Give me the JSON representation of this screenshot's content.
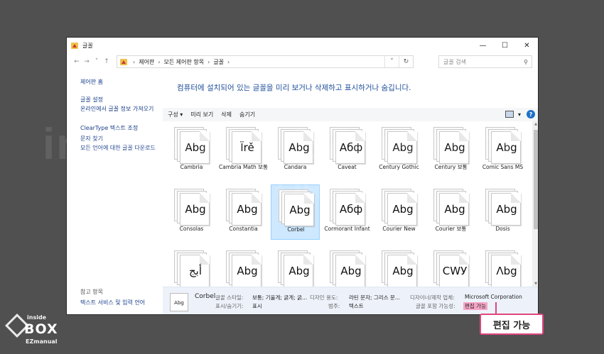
{
  "watermark": {
    "line1": "insideBOX EZmanual",
    "line2": "TUTORIAL"
  },
  "window": {
    "title": "글꼴",
    "controls": [
      "—",
      "☐",
      "✕"
    ]
  },
  "nav": {
    "back": "←",
    "forward": "→",
    "recent": "˅",
    "up": "↑"
  },
  "address": {
    "crumbs": [
      "제어판",
      "모든 제어판 항목",
      "글꼴"
    ],
    "dropdown": "˅",
    "refresh": "↻"
  },
  "search": {
    "placeholder": "글꼴 검색",
    "icon": "⚲"
  },
  "sidebar": {
    "home": "제어판 홈",
    "links": [
      "글꼴 설정",
      "온라인에서 글꼴 정보 가져오기",
      "ClearType 텍스트 조정",
      "문자 찾기",
      "모든 언어에 대한 글꼴 다운로드"
    ],
    "see_also_heading": "참고 항목",
    "see_also_link": "텍스트 서비스 및 입력 언어"
  },
  "main": {
    "title": "컴퓨터에 설치되어 있는 글꼴을 미리 보거나 삭제하고 표시하거나 숨깁니다."
  },
  "toolbar": {
    "organize": "구성 ▾",
    "preview": "미리 보기",
    "delete": "삭제",
    "hide": "숨기기",
    "help": "?",
    "view_menu": "▾"
  },
  "fonts": [
    {
      "name": "Cambria",
      "sample": "Abg"
    },
    {
      "name": "Cambria Math 보통",
      "sample": "Ïrě"
    },
    {
      "name": "Candara",
      "sample": "Abg"
    },
    {
      "name": "Caveat",
      "sample": "Абф"
    },
    {
      "name": "Century Gothic",
      "sample": "Abg"
    },
    {
      "name": "Century 보통",
      "sample": "Abg"
    },
    {
      "name": "Comic Sans MS",
      "sample": "Abg"
    },
    {
      "name": "Consolas",
      "sample": "Abg"
    },
    {
      "name": "Constantia",
      "sample": "Abg"
    },
    {
      "name": "Corbel",
      "sample": "Abg",
      "selected": true
    },
    {
      "name": "Cormorant Infant",
      "sample": "Абф"
    },
    {
      "name": "Courier New",
      "sample": "Abg"
    },
    {
      "name": "Courier 보통",
      "sample": "Abg"
    },
    {
      "name": "Dosis",
      "sample": "Abg"
    },
    {
      "name": "",
      "sample": "أبج"
    },
    {
      "name": "",
      "sample": "Abg"
    },
    {
      "name": "",
      "sample": "Abg"
    },
    {
      "name": "",
      "sample": "Abg"
    },
    {
      "name": "",
      "sample": "Abg"
    },
    {
      "name": "",
      "sample": "СWУ"
    },
    {
      "name": "",
      "sample": "Λbg"
    }
  ],
  "details": {
    "thumb": "Abg",
    "name": "Corbel",
    "style_label": "글꼴 스타일:",
    "style_value": "보통; 기울게; 굵게; 굵...",
    "visibility_label": "표시/숨기기:",
    "visibility_value": "표시",
    "purpose_label": "디자인 용도:",
    "purpose_value": "라틴 문자; 그리스 문...",
    "category_label": "범주:",
    "category_value": "텍스트",
    "designer_label": "디자이너/제작 업체:",
    "designer_value": "Microsoft Corporation",
    "embed_label": "글꼴 포함 가능성:",
    "embed_value": "편집 가능"
  },
  "callout": {
    "text": "편집 가능"
  },
  "logo": {
    "top": "inside",
    "main": "BOX",
    "bottom": "EZmanual"
  }
}
